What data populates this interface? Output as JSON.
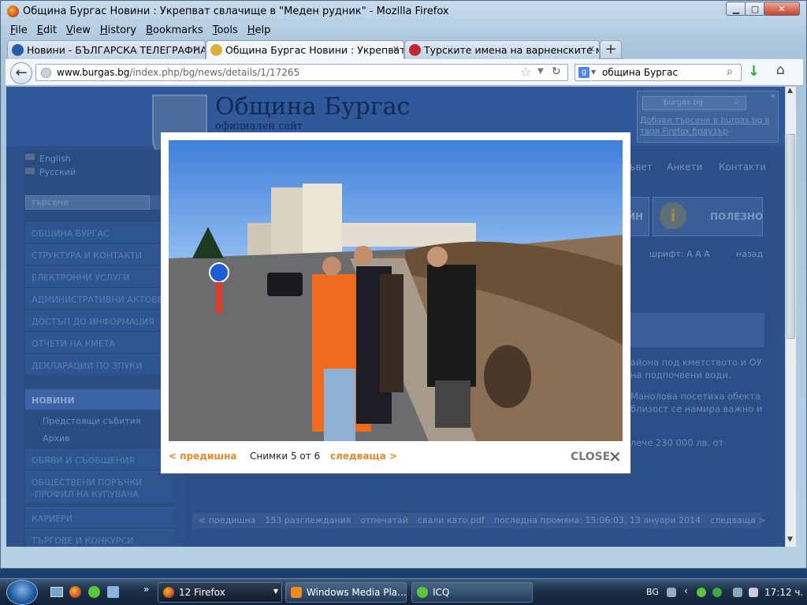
{
  "window": {
    "title": "Община Бургас Новини : Укрепват свлачище в \"Меден рудник\" - Mozilla Firefox",
    "controls": {
      "minimize": "▁",
      "maximize": "▢",
      "close": "✕"
    }
  },
  "menubar": [
    {
      "label": "File",
      "u": "F",
      "rest": "ile"
    },
    {
      "label": "Edit",
      "u": "E",
      "rest": "dit"
    },
    {
      "label": "View",
      "u": "V",
      "rest": "iew"
    },
    {
      "label": "History",
      "u": "H",
      "rest": "istory"
    },
    {
      "label": "Bookmarks",
      "u": "B",
      "rest": "ookmarks"
    },
    {
      "label": "Tools",
      "u": "T",
      "rest": "ools"
    },
    {
      "label": "Help",
      "u": "H",
      "rest": "elp"
    }
  ],
  "tabs": [
    {
      "label": "Новини - БЪЛГАРСКА ТЕЛЕГРАФНА...",
      "active": false,
      "icon_color": "#2a5ca8"
    },
    {
      "label": "Община Бургас Новини : Укрепват ...",
      "active": true,
      "icon_color": "#d8b13a"
    },
    {
      "label": "Турските имена на варненските ме...",
      "active": false,
      "icon_color": "#c0283a"
    }
  ],
  "newtab_label": "+",
  "navbar": {
    "url_domain": "www.burgas.bg",
    "url_path": "/index.php/bg/news/details/1/17265",
    "search_value": "община Бургас"
  },
  "site": {
    "title": "Община Бургас",
    "subtitle": "официален сайт",
    "lang_en": "English",
    "lang_ru": "Русский",
    "search_placeholder": "търсене",
    "sidebar_items": [
      "ОБЩИНА БУРГАС",
      "СТРУКТУРА И КОНТАКТИ",
      "ЕЛЕКТРОННИ УСЛУГИ",
      "АДМИНИСТРАТИВНИ АКТОВЕ",
      "ДОСТЪП ДО ИНФОРМАЦИЯ",
      "ОТЧЕТИ НА КМЕТА",
      "ДЕКЛАРАЦИИ ПО ЗПУКИ"
    ],
    "news_label": "НОВИНИ",
    "news_sub": [
      "Предстоящи събития",
      "Архив"
    ],
    "sidebar_items_2": [
      "ОБЯВИ И СЪОБЩЕНИЯ",
      "ОБЩЕСТВЕНИ ПОРЪЧКИ -ПРОФИЛ НА КУПУВАЧА",
      "КАРИЕРИ",
      "ТЪРГОВЕ И КОНКУРСИ"
    ],
    "top_links": [
      "ъвет",
      "Анкети",
      "Контакти"
    ],
    "box_left": "ЙН",
    "box_polezno": "ПОЛЕЗНО",
    "font_line": "шрифт: A A A",
    "back_link": "назад",
    "body_lines": [
      "айона под кметството и ОУ",
      "на подпочвени води.",
      "Манолова посетиха обекта",
      "близост се намира важно и",
      "лече 230 000 лв. от"
    ],
    "bottom": {
      "prev": "< предишна",
      "views": "153 разглеждания",
      "print": "отпечатай",
      "pdf": "свали като pdf",
      "modified": "последна промяна: 15:06:03, 13 януари 2014",
      "next": "следваща >"
    },
    "ff_search_placeholder": "burgas.bg",
    "ff_search_link": "Добави търсене в burgas.bg в твоя Firefox браузър"
  },
  "lightbox": {
    "prev": "< предишна",
    "counter": "Снимки 5 от 6",
    "next": "следваща >",
    "close": "CLOSE",
    "close_icon": "✕"
  },
  "taskbar": {
    "firefox": "12 Firefox",
    "wmp": "Windows Media Pla...",
    "icq": "ICQ",
    "lang": "BG",
    "clock": "17:12 ч."
  }
}
